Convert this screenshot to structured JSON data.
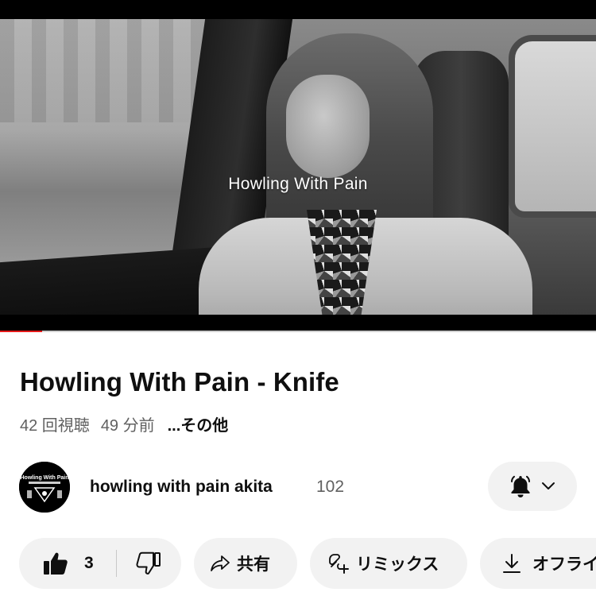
{
  "video": {
    "overlay_title": "Howling With Pain",
    "progress_fraction": 0.07,
    "progress_color": "#e61919"
  },
  "title": "Howling With Pain - Knife",
  "meta": {
    "views": "42 回視聴",
    "time_ago": "49 分前",
    "more": "...その他"
  },
  "channel": {
    "name": "howling with pain akita",
    "subscribers": "102",
    "avatar_text": "Howling With Pain",
    "bell_icon": "bell-icon",
    "chevron_icon": "chevron-down-icon"
  },
  "actions": {
    "like_count": "3",
    "share_label": "共有",
    "remix_label": "リミックス",
    "offline_label": "オフライン"
  },
  "colors": {
    "pill_background": "#f2f2f2",
    "text_primary": "#0f0f0f",
    "text_secondary": "#606060"
  }
}
